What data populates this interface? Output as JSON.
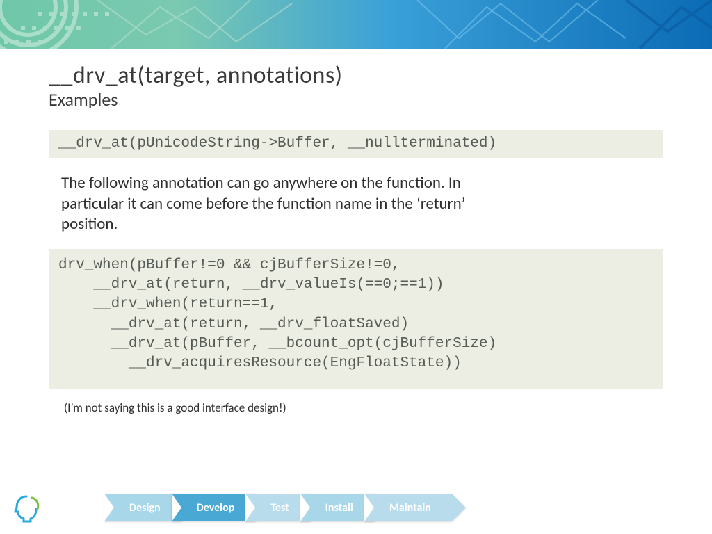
{
  "title": "__drv_at(target, annotations)",
  "subtitle": "Examples",
  "code1": "__drv_at(pUnicodeString->Buffer, __nullterminated)",
  "paragraph": "The following annotation can go anywhere on the function. In particular it can come before the function name in the ‘return’ position.",
  "code2": "drv_when(pBuffer!=0 && cjBufferSize!=0,\n    __drv_at(return, __drv_valueIs(==0;==1))\n    __drv_when(return==1,\n      __drv_at(return, __drv_floatSaved)\n      __drv_at(pBuffer, __bcount_opt(cjBufferSize)\n        __drv_acquiresResource(EngFloatState))",
  "aside": "(I’m not saying this is a good interface design!)",
  "phases": [
    "Design",
    "Develop",
    "Test",
    "Install",
    "Maintain"
  ],
  "colors": {
    "banner_start": "#6fc7a9",
    "banner_end": "#0b6bb5",
    "code_bg": "#eceee4",
    "code_fg": "#555b55",
    "arrow_light": "#a9d7ea",
    "arrow_mid": "#4aa9d4"
  }
}
